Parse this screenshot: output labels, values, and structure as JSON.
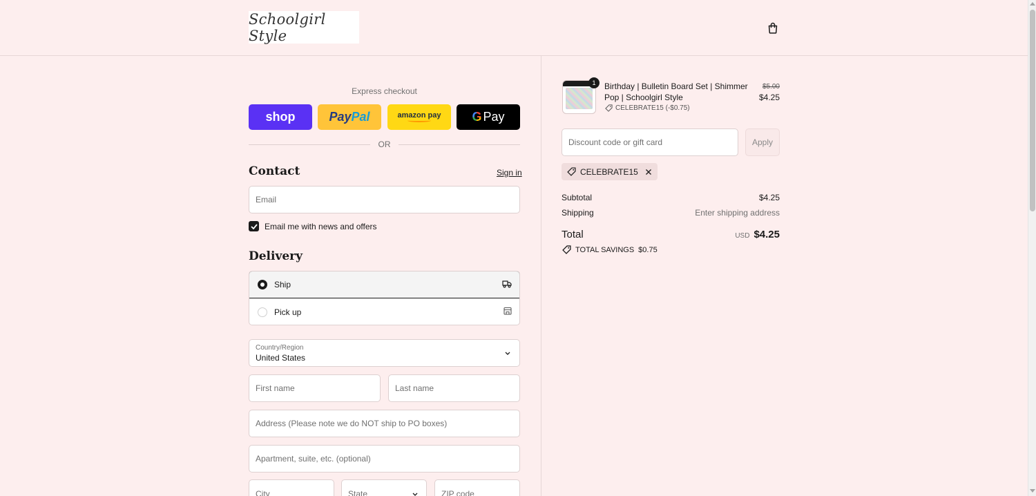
{
  "header": {
    "logo_text": "Schoolgirl Style",
    "cart_icon": "shopping-bag-icon"
  },
  "express": {
    "title": "Express checkout",
    "shop_label": "shop",
    "paypal_label_1": "Pay",
    "paypal_label_2": "Pal",
    "amazon_label": "amazon pay",
    "gpay_g": "G",
    "gpay_label": "Pay",
    "or_label": "OR"
  },
  "contact": {
    "title": "Contact",
    "signin_label": "Sign in",
    "email_placeholder": "Email",
    "newsletter_label": "Email me with news and offers",
    "newsletter_checked": true
  },
  "delivery": {
    "title": "Delivery",
    "options": [
      {
        "label": "Ship",
        "selected": true,
        "icon": "truck-icon"
      },
      {
        "label": "Pick up",
        "selected": false,
        "icon": "store-icon"
      }
    ],
    "country_label": "Country/Region",
    "country_value": "United States",
    "first_name_placeholder": "First name",
    "last_name_placeholder": "Last name",
    "address_placeholder": "Address (Please note we do NOT ship to PO boxes)",
    "apartment_placeholder": "Apartment, suite, etc. (optional)",
    "city_placeholder": "City",
    "state_placeholder": "State",
    "zip_placeholder": "ZIP code"
  },
  "summary": {
    "item": {
      "quantity": "1",
      "name": "Birthday | Bulletin Board Set | Shimmer Pop | Schoolgirl Style",
      "discount": "CELEBRATE15 (-$0.75)",
      "price_original": "$5.00",
      "price_final": "$4.25"
    },
    "discount_placeholder": "Discount code or gift card",
    "apply_label": "Apply",
    "applied_code": "CELEBRATE15",
    "subtotal_label": "Subtotal",
    "subtotal_value": "$4.25",
    "shipping_label": "Shipping",
    "shipping_value": "Enter shipping address",
    "total_label": "Total",
    "currency": "USD",
    "total_value": "$4.25",
    "savings_label": "TOTAL SAVINGS",
    "savings_value": "$0.75"
  },
  "colors": {
    "background": "#fdeeee",
    "shop_pay": "#5a31f4",
    "paypal": "#ffc439",
    "amazon_pay": "#ffd814",
    "google_pay": "#000000"
  }
}
